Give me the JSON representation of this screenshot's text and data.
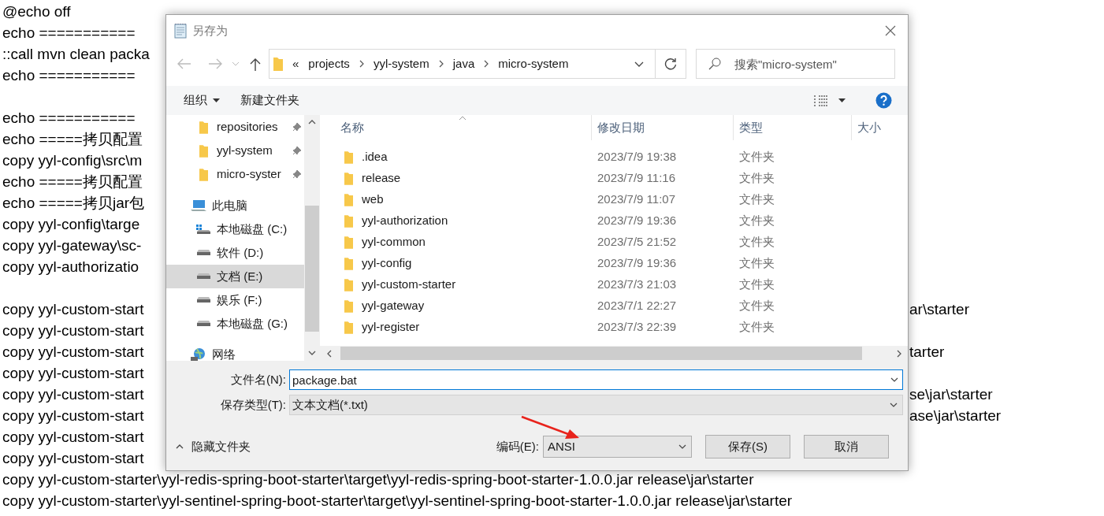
{
  "editor_lines": [
    {
      "kind": "text",
      "left": "@echo off"
    },
    {
      "kind": "text",
      "left": "echo ==========="
    },
    {
      "kind": "text",
      "left": "::call mvn clean packa"
    },
    {
      "kind": "text",
      "left": "echo ==========="
    },
    {
      "kind": "blank"
    },
    {
      "kind": "text",
      "left": "echo ==========="
    },
    {
      "kind": "text",
      "left": "echo =====拷贝配置"
    },
    {
      "kind": "text",
      "left": "copy yyl-config\\src\\m"
    },
    {
      "kind": "text",
      "left": "echo =====拷贝配置"
    },
    {
      "kind": "text",
      "left": "echo =====拷贝jar包"
    },
    {
      "kind": "text",
      "left": "copy yyl-config\\targe"
    },
    {
      "kind": "text",
      "left": "copy yyl-gateway\\sc-"
    },
    {
      "kind": "text",
      "left": "copy yyl-authorizatio"
    },
    {
      "kind": "blank"
    },
    {
      "kind": "text",
      "left": "copy yyl-custom-start",
      "right": "ar\\starter"
    },
    {
      "kind": "text",
      "left": "copy yyl-custom-start"
    },
    {
      "kind": "text",
      "left": "copy yyl-custom-start",
      "right": "tarter"
    },
    {
      "kind": "text",
      "left": "copy yyl-custom-start"
    },
    {
      "kind": "text",
      "left": "copy yyl-custom-start",
      "right": "se\\jar\\starter"
    },
    {
      "kind": "text",
      "left": "copy yyl-custom-start",
      "right": "ase\\jar\\starter"
    },
    {
      "kind": "text",
      "left": "copy yyl-custom-start"
    },
    {
      "kind": "text",
      "left": "copy yyl-custom-start"
    },
    {
      "kind": "text",
      "left": "copy yyl-custom-starter\\yyl-redis-spring-boot-starter\\target\\yyl-redis-spring-boot-starter-1.0.0.jar release\\jar\\starter"
    },
    {
      "kind": "text",
      "left": "copy yyl-custom-starter\\yyl-sentinel-spring-boot-starter\\target\\yyl-sentinel-spring-boot-starter-1.0.0.jar release\\jar\\starter"
    }
  ],
  "dialog": {
    "title": "另存为",
    "breadcrumb": [
      "«",
      "projects",
      "yyl-system",
      "java",
      "micro-system"
    ],
    "search": {
      "placeholder": "搜索\"micro-system\""
    },
    "toolbar": {
      "organize": "组织",
      "new_folder": "新建文件夹"
    },
    "nav_items": [
      {
        "label": "repositories",
        "kind": "folder",
        "pinned": true,
        "selected": false
      },
      {
        "label": "yyl-system",
        "kind": "folder",
        "pinned": true,
        "selected": false
      },
      {
        "label": "micro-syster",
        "kind": "folder",
        "pinned": true,
        "selected": false
      },
      {
        "label": "此电脑",
        "kind": "computer",
        "selected": false,
        "children": [
          {
            "label": "本地磁盘 (C:)",
            "kind": "system-drive",
            "selected": false
          },
          {
            "label": "软件 (D:)",
            "kind": "drive",
            "selected": false
          },
          {
            "label": "文档 (E:)",
            "kind": "drive",
            "selected": true
          },
          {
            "label": "娱乐 (F:)",
            "kind": "drive",
            "selected": false
          },
          {
            "label": "本地磁盘 (G:)",
            "kind": "drive",
            "selected": false
          }
        ]
      },
      {
        "label": "网络",
        "kind": "network",
        "selected": false
      }
    ],
    "columns": [
      "名称",
      "修改日期",
      "类型",
      "大小"
    ],
    "files": [
      {
        "name": ".idea",
        "date": "2023/7/9 19:38",
        "type": "文件夹"
      },
      {
        "name": "release",
        "date": "2023/7/9 11:16",
        "type": "文件夹"
      },
      {
        "name": "web",
        "date": "2023/7/9 11:07",
        "type": "文件夹"
      },
      {
        "name": "yyl-authorization",
        "date": "2023/7/9 19:36",
        "type": "文件夹"
      },
      {
        "name": "yyl-common",
        "date": "2023/7/5 21:52",
        "type": "文件夹"
      },
      {
        "name": "yyl-config",
        "date": "2023/7/9 19:36",
        "type": "文件夹"
      },
      {
        "name": "yyl-custom-starter",
        "date": "2023/7/3 21:03",
        "type": "文件夹"
      },
      {
        "name": "yyl-gateway",
        "date": "2023/7/1 22:27",
        "type": "文件夹"
      },
      {
        "name": "yyl-register",
        "date": "2023/7/3 22:39",
        "type": "文件夹"
      }
    ],
    "filename": {
      "label": "文件名(N):",
      "value": "package.bat"
    },
    "filetype": {
      "label": "保存类型(T):",
      "value": "文本文档(*.txt)"
    },
    "hide_folders": "隐藏文件夹",
    "encoding": {
      "label": "编码(E):",
      "value": "ANSI"
    },
    "buttons": [
      "保存(S)",
      "取消"
    ]
  }
}
